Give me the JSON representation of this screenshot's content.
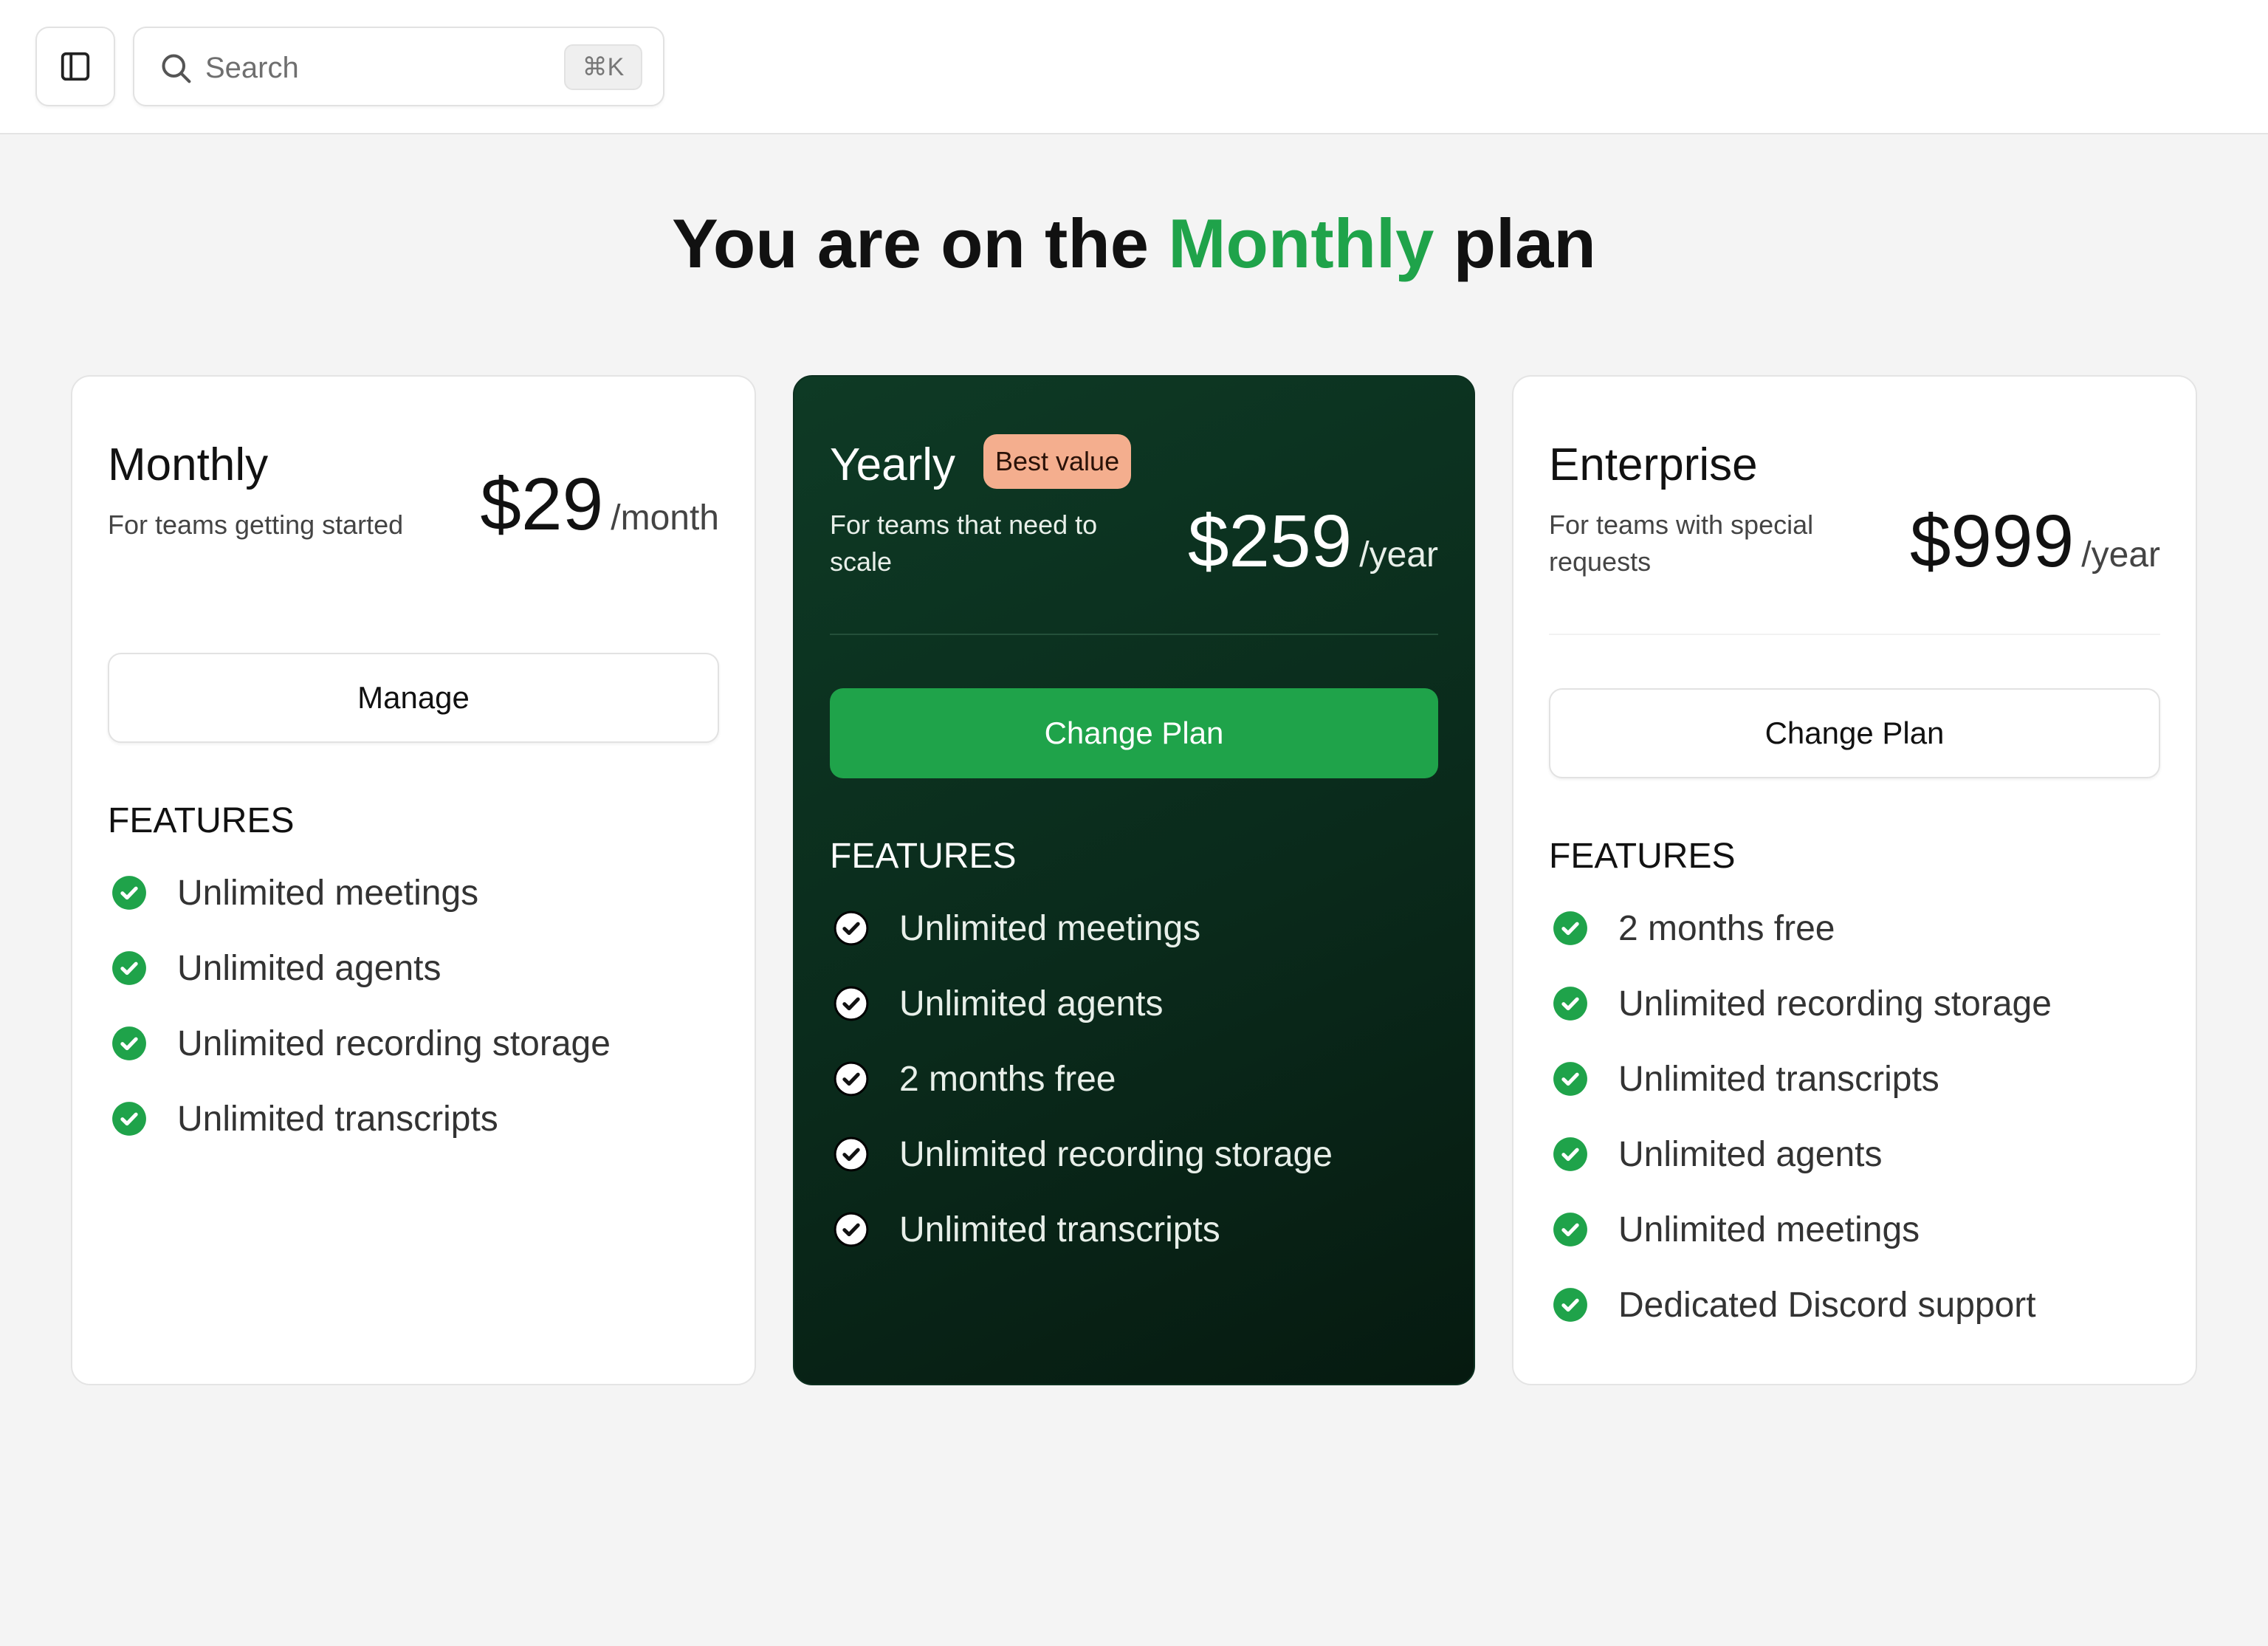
{
  "search": {
    "placeholder": "Search",
    "shortcut": "⌘K"
  },
  "headline": {
    "prefix": "You are on the",
    "plan": "Monthly",
    "suffix": "plan"
  },
  "colors": {
    "accent": "#1fa34a",
    "badge": "#f4ae8e",
    "dark_card": "#0a2a1b"
  },
  "plans": [
    {
      "name": "Monthly",
      "description": "For teams getting started",
      "price": "$29",
      "period": "/month",
      "button": "Manage",
      "features_title": "FEATURES",
      "features": [
        "Unlimited meetings",
        "Unlimited agents",
        "Unlimited recording storage",
        "Unlimited transcripts"
      ]
    },
    {
      "name": "Yearly",
      "badge": "Best value",
      "description": "For teams that need to scale",
      "price": "$259",
      "period": "/year",
      "button": "Change Plan",
      "features_title": "FEATURES",
      "features": [
        "Unlimited meetings",
        "Unlimited agents",
        "2 months free",
        "Unlimited recording storage",
        "Unlimited transcripts"
      ]
    },
    {
      "name": "Enterprise",
      "description": "For teams with special requests",
      "price": "$999",
      "period": "/year",
      "button": "Change Plan",
      "features_title": "FEATURES",
      "features": [
        "2 months free",
        "Unlimited recording storage",
        "Unlimited transcripts",
        "Unlimited agents",
        "Unlimited meetings",
        "Dedicated Discord support"
      ]
    }
  ]
}
